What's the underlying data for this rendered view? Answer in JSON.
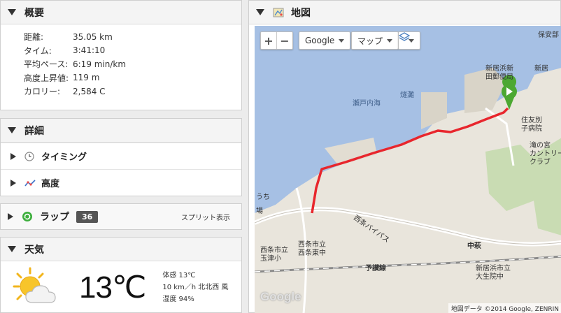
{
  "summary": {
    "title": "概要",
    "stats": [
      {
        "label": "距離:",
        "value": "35.05 km"
      },
      {
        "label": "タイム:",
        "value": "3:41:10"
      },
      {
        "label": "平均ペース:",
        "value": "6:19 min/km"
      },
      {
        "label": "高度上昇値:",
        "value": "119 m"
      },
      {
        "label": "カロリー:",
        "value": "2,584 C"
      }
    ]
  },
  "details": {
    "title": "詳細",
    "items": [
      {
        "label": "タイミング",
        "icon": "clock-icon"
      },
      {
        "label": "高度",
        "icon": "elevation-icon"
      }
    ]
  },
  "laps": {
    "title": "ラップ",
    "count": "36",
    "split_label": "スプリット表示"
  },
  "weather": {
    "title": "天気",
    "temperature": "13℃",
    "feels_like": "体感 13℃",
    "wind": "10 km／h 北北西 風",
    "humidity": "湿度 94%",
    "icon": "partly-cloudy-icon"
  },
  "map": {
    "title": "地図",
    "map_type_provider": "Google",
    "map_type": "マップ",
    "labels": {
      "sea": "瀬戸内海",
      "nada": "燧灘",
      "post_office": "新居浜新田郵便局",
      "post_office_top": "新居浜新",
      "post_office_mid": "田郵便局",
      "hospital_a": "住友別",
      "hospital_b": "子病院",
      "takinomiya_a": "滝の宮",
      "takinomiya_b": "カントリー",
      "takinomiya_c": "クラブ",
      "hoan": "保安部",
      "nishijo_a": "西条市立",
      "nishijo_b": "玉津小",
      "nishijo_c": "西条市立",
      "nishijo_d": "西条東中",
      "bypass": "西条バイパス",
      "yosan": "予讃線",
      "nakahagi": "中萩",
      "daisei_a": "新居浜市立",
      "daisei_b": "大生院中",
      "uchi": "うち",
      "ba": "場",
      "top_right_a": "保安部",
      "top_right_b": "新居浜",
      "top_right_c": "新居"
    },
    "attribution": "地図データ ©2014 Google, ZENRIN",
    "watermark": "Google",
    "route_color": "#e8262d",
    "sea_color": "#a6c0e4",
    "land_color": "#e9e5dc"
  }
}
